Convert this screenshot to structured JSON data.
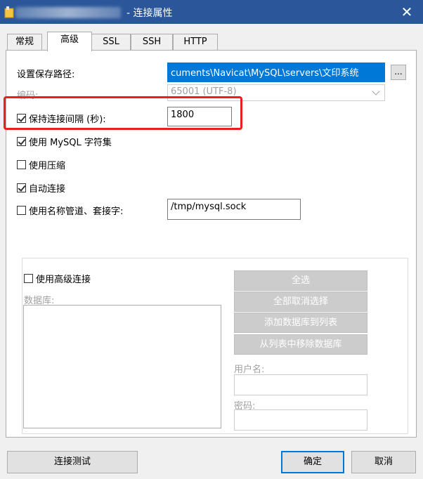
{
  "window": {
    "title": "- 连接属性",
    "close_glyph": "✕"
  },
  "tabs": [
    {
      "label": "常规"
    },
    {
      "label": "高级"
    },
    {
      "label": "SSL"
    },
    {
      "label": "SSH"
    },
    {
      "label": "HTTP"
    }
  ],
  "settings_path": {
    "label": "设置保存路径:",
    "value": "cuments\\Navicat\\MySQL\\servers\\文印系统",
    "browse_label": "..."
  },
  "encoding": {
    "label": "编码:",
    "value": "65001 (UTF-8)"
  },
  "keepalive": {
    "label": "保持连接间隔 (秒):",
    "checked": true,
    "value": "1800"
  },
  "use_mysql_charset": {
    "label": "使用 MySQL 字符集",
    "checked": true
  },
  "use_compression": {
    "label": "使用压缩",
    "checked": false
  },
  "auto_connect": {
    "label": "自动连接",
    "checked": true
  },
  "named_pipe": {
    "label": "使用名称管道、套接字:",
    "checked": false,
    "value": "/tmp/mysql.sock"
  },
  "advanced": {
    "label": "使用高级连接",
    "checked": false,
    "databases_label": "数据库:",
    "select_all": "全选",
    "deselect_all": "全部取消选择",
    "add_db": "添加数据库到列表",
    "remove_db": "从列表中移除数据库",
    "username_label": "用户名:",
    "password_label": "密码:"
  },
  "footer": {
    "test": "连接测试",
    "ok": "确定",
    "cancel": "取消"
  },
  "colors": {
    "titlebar": "#2b579a",
    "selection": "#0078d7",
    "highlight_box": "#e8211a"
  }
}
